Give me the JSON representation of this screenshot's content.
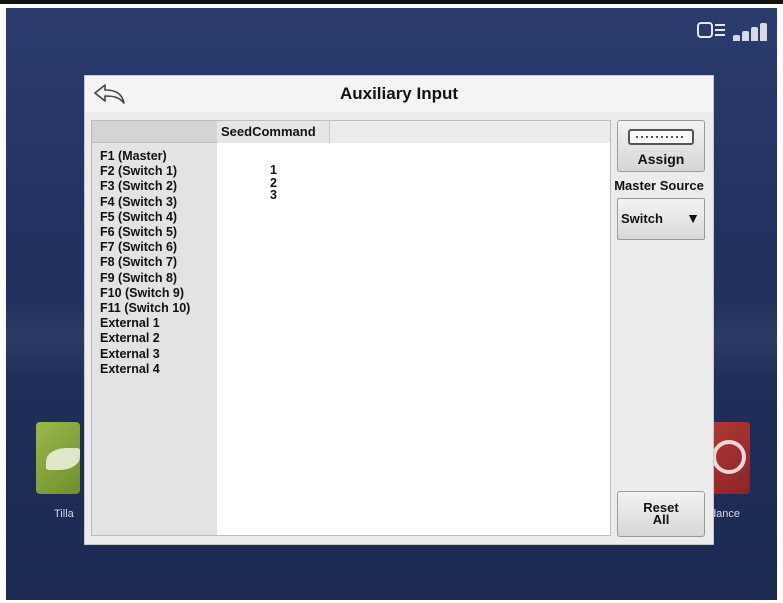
{
  "dialog": {
    "title": "Auxiliary Input",
    "back_icon": "back-arrow-icon"
  },
  "table": {
    "function_header": "",
    "column_header": "SeedCommand",
    "functions": [
      "F1 (Master)",
      "F2 (Switch 1)",
      "F3 (Switch 2)",
      "F4 (Switch 3)",
      "F5 (Switch 4)",
      "F6 (Switch 5)",
      "F7 (Switch 6)",
      "F8 (Switch 7)",
      "F9 (Switch 8)",
      "F10 (Switch 9)",
      "F11 (Switch 10)",
      "External 1",
      "External 2",
      "External 3",
      "External 4"
    ],
    "assignments": [
      "1",
      "2",
      "3"
    ]
  },
  "side": {
    "assign_label": "Assign",
    "master_source_label": "Master Source",
    "master_source_value": "Switch",
    "master_source_arrow": "▼",
    "reset_line1": "Reset",
    "reset_line2": "All"
  },
  "background": {
    "left_app_label": "Tilla",
    "right_app_label": "dance"
  },
  "colors": {
    "screen_bg": "#22325f",
    "dialog_bg": "#ececec",
    "tile_green": "#8aa83c",
    "tile_red": "#a83030"
  }
}
